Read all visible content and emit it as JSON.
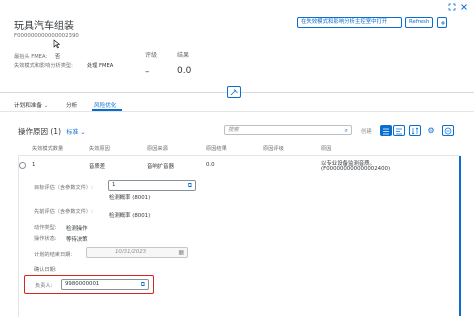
{
  "header": {
    "title": "玩具汽车组装",
    "subtitle": "F000000000000002390",
    "fmea_header_label": "最抬头 FMEA:",
    "fmea_header_value": "否",
    "analysis_type_label": "失效模式和影响分析类型:",
    "analysis_type_value": "处理 FMEA",
    "rating_label": "评级",
    "rating_value": "–",
    "result_label": "结果",
    "result_value": "0.0",
    "open_button": "在失效模式和影响分析主控室中打开",
    "refresh_button": "Refresh"
  },
  "tabs": [
    {
      "label": "计划和准备",
      "has_chevron": true
    },
    {
      "label": "分析",
      "has_chevron": false
    },
    {
      "label": "风险优化",
      "has_chevron": false
    }
  ],
  "table": {
    "title": "操作原因 (1)",
    "variant": "标准",
    "search_placeholder": "搜索",
    "create_label": "创建",
    "columns": [
      "失效模式数量",
      "失效原因",
      "原因来源",
      "原因结果",
      "原因评级",
      "原因"
    ],
    "row": {
      "count": "1",
      "failure_cause": "音质差",
      "cause_source": "音响扩音器",
      "cause_result": "0.0",
      "cause_rating": "",
      "cause_text": "以专业设备监测音质。",
      "cause_id": "(F000000000000002400)"
    }
  },
  "detail": {
    "target_rating_label": "目标评估（含参数文件）:",
    "target_rating_value": "1",
    "target_rating_hint": "检测概率 (8001)",
    "prior_rating_label": "先前评估（含参数文件）:",
    "prior_rating_value": "检测概率 (8001)",
    "action_type_label": "动作类型:",
    "action_type_value": "检测操作",
    "action_status_label": "操作状态:",
    "action_status_value": "等待决策",
    "planned_end_label": "计划的结束日期:",
    "planned_end_value": "10/31/2023",
    "confirm_date_label": "确认日期:",
    "responsible_label": "负责人:",
    "responsible_value": "9980000001"
  },
  "colors": {
    "accent": "#0a6ed1",
    "highlight_border": "#d6261d"
  }
}
